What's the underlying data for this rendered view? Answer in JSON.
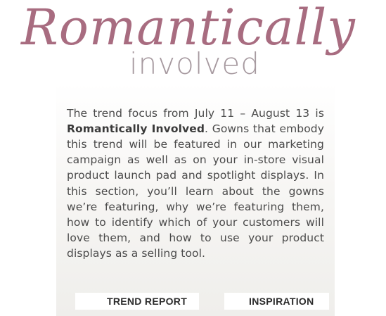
{
  "header": {
    "title_script": "Romantically",
    "title_sub": "involved"
  },
  "intro": {
    "before": "The trend focus from July 11 – August 13 is ",
    "highlight": "Romantically Involved",
    "after": ". Gowns that embody this trend will be featured in our marketing campaign as well as on your in-store visual product launch pad and spotlight displays. In this section, you’ll learn about the gowns we’re featuring, why we’re featuring them, how to identify which of your customers will love them, and how to use your product displays as a selling tool."
  },
  "nav": {
    "trend_report": "TREND REPORT",
    "inspiration": "INSPIRATION"
  },
  "colors": {
    "script_title": "#a86c80",
    "subtitle": "#a79aa0",
    "body_text": "#4a4a4a"
  }
}
